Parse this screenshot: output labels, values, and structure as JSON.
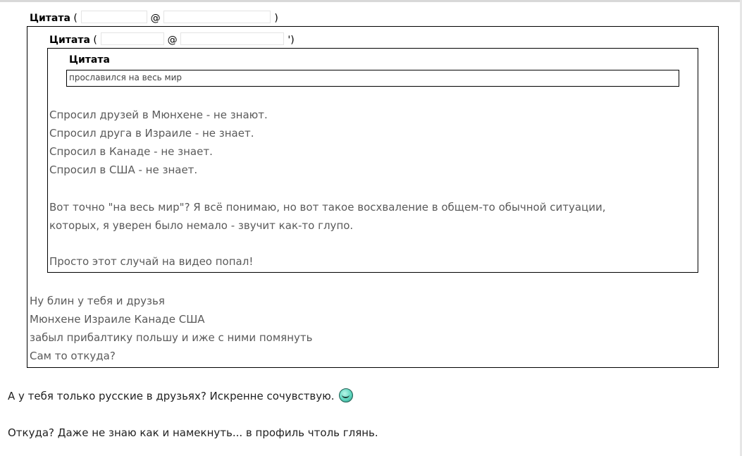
{
  "quote1": {
    "label": "Цитата",
    "open_paren": " (",
    "at": "@",
    "close_paren": ")"
  },
  "quote2": {
    "label": "Цитата",
    "open_paren": " (",
    "at": "@",
    "close_paren": "')"
  },
  "quote3": {
    "label": "Цитата",
    "content": "прославился на весь мир"
  },
  "quote2_body": [
    "Спросил друзей в Мюнхене - не знают.",
    "Спросил друга в Израиле - не знает.",
    "Спросил в Канаде - не знает.",
    "Спросил в США - не знает.",
    "Вот точно \"на весь мир\"? Я всё понимаю, но вот такое восхваление в общем-то обычной ситуации,",
    "которых, я уверен было немало - звучит как-то глупо.",
    "Просто этот случай на видео попал!"
  ],
  "quote1_body": [
    "Ну блин у тебя и друзья",
    "Мюнхене Израиле Канаде США",
    "забыл прибалтику польшу и иже с ними помянуть",
    "Сам то откуда?"
  ],
  "reply": [
    "А у тебя только русские в друзьях? Искренне сочувствую.",
    "Откуда? Даже не знаю как и намекнуть... в профиль чтоль глянь."
  ],
  "icons": {
    "smiley": "smiley-icon"
  }
}
